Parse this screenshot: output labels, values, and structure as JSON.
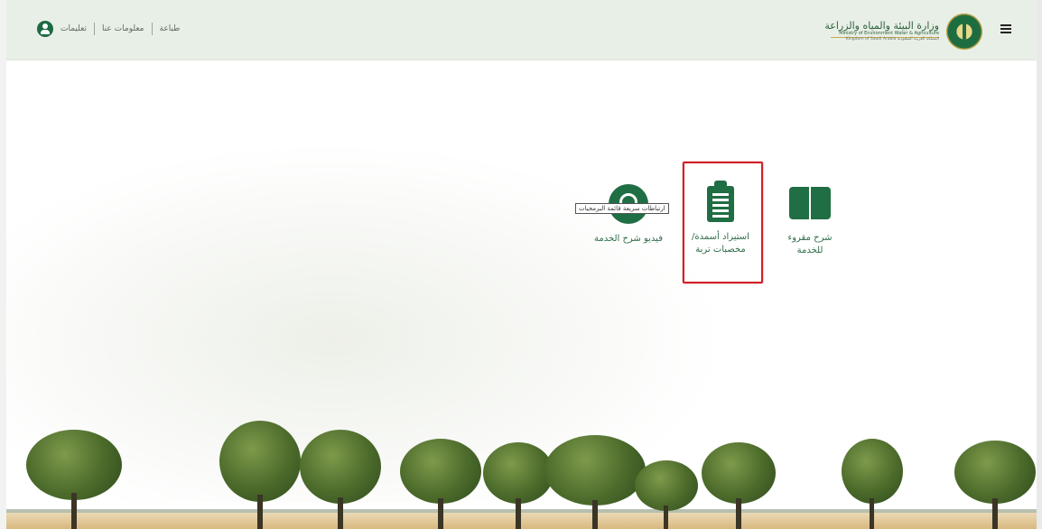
{
  "header": {
    "top_links": [
      "طباعة",
      "معلومات عنا",
      "تعليمات"
    ],
    "brand": {
      "arabic_name": "وزارة البيئة والمياه والزراعة",
      "english_name": "Ministry of Environment Water & Agriculture",
      "sub_line": "Kingdom of Saudi Arabia  المملكة العربية السعودية"
    },
    "icons": [
      "user-icon",
      "ministry-logo",
      "hamburger-menu-icon"
    ]
  },
  "services": [
    {
      "label": "شرح مقروء للخدمة",
      "icon": "book-icon"
    },
    {
      "label": "استيراد أسمدة/ مخصبات تربة",
      "icon": "clipboard-icon"
    },
    {
      "label": "فيديو شرح الخدمة",
      "icon": "magnifier-icon"
    }
  ],
  "tooltip": {
    "text": "ارتباطات سريعة قائمة البرمجيات"
  },
  "colors": {
    "accent": "#1f6e44",
    "header_bg": "#e8efe6",
    "highlight": "#d02027",
    "text_green": "#2f6d49"
  }
}
